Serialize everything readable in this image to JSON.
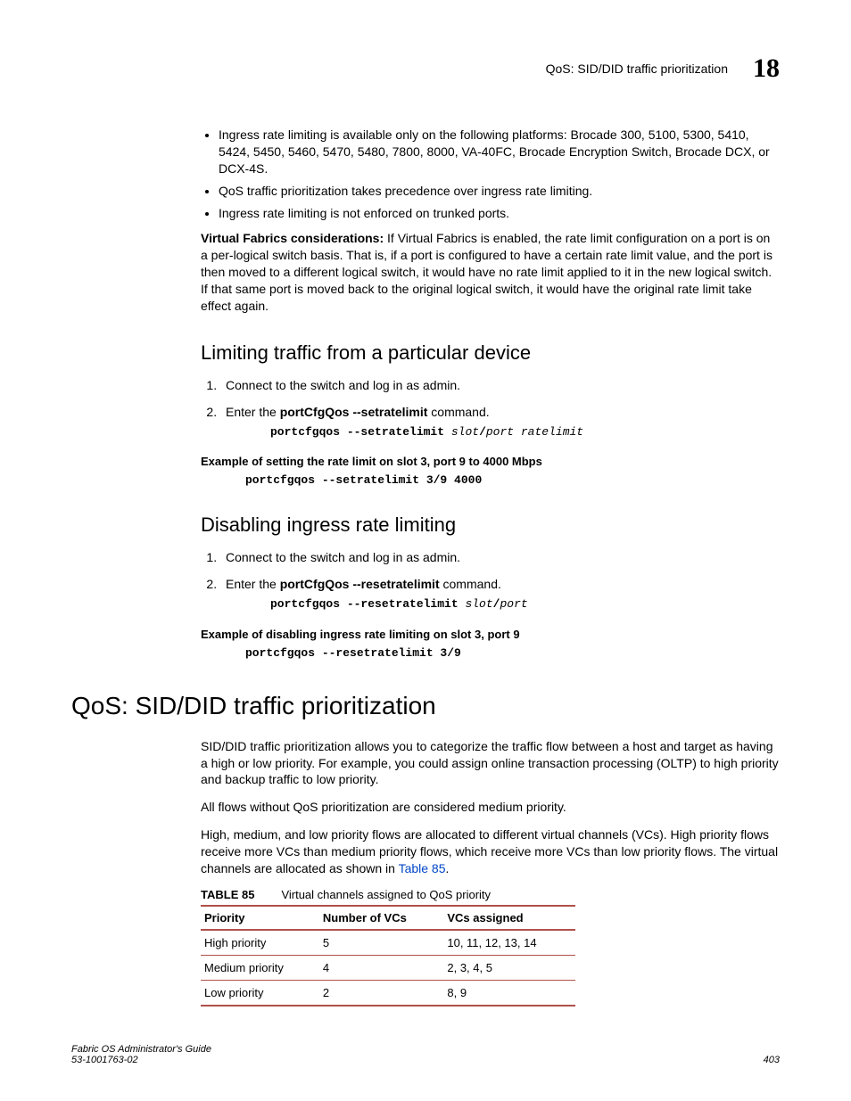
{
  "header": {
    "breadcrumb": "QoS: SID/DID traffic prioritization",
    "chapter_number": "18"
  },
  "bullets": [
    "Ingress rate limiting is available only on the following platforms: Brocade 300, 5100, 5300, 5410, 5424, 5450, 5460, 5470, 5480, 7800, 8000, VA-40FC, Brocade Encryption Switch, Brocade DCX, or DCX-4S.",
    "QoS traffic prioritization takes precedence over ingress rate limiting.",
    "Ingress rate limiting is not enforced on trunked ports."
  ],
  "vf_para_bold": "Virtual Fabrics considerations: ",
  "vf_para": "If Virtual Fabrics is enabled, the rate limit configuration on a port is on a per-logical switch basis. That is, if a port is configured to have a certain rate limit value, and the port is then moved to a different logical switch, it would have no rate limit applied to it in the new logical switch. If that same port is moved back to the original logical switch, it would have the original rate limit take effect again.",
  "section1": {
    "title": "Limiting traffic from a particular device",
    "step1": "Connect to the switch and log in as admin.",
    "step2_pre": "Enter the ",
    "step2_cmd": "portCfgQos --setratelimit",
    "step2_post": " command.",
    "code1_a": "portcfgqos --setratelimit ",
    "code1_b": "slot",
    "code1_c": "/",
    "code1_d": "port ratelimit",
    "ex_head": "Example of setting the rate limit on slot 3, port 9 to 4000 Mbps",
    "ex_code": "portcfgqos --setratelimit 3/9 4000"
  },
  "section2": {
    "title": "Disabling ingress rate limiting",
    "step1": "Connect to the switch and log in as admin.",
    "step2_pre": "Enter the ",
    "step2_cmd": "portCfgQos --resetratelimit",
    "step2_post": " command.",
    "code1_a": "portcfgqos --resetratelimit ",
    "code1_b": "slot",
    "code1_c": "/",
    "code1_d": "port",
    "ex_head": "Example of disabling ingress rate limiting on slot 3, port 9",
    "ex_code": "portcfgqos --resetratelimit 3/9"
  },
  "main_heading": "QoS: SID/DID traffic prioritization",
  "p1": "SID/DID traffic prioritization allows you to categorize the traffic flow between a host and target as having a high or low priority. For example, you could assign online transaction processing (OLTP) to high priority and backup traffic to low priority.",
  "p2": "All flows without QoS prioritization are considered medium priority.",
  "p3_a": "High, medium, and low priority flows are allocated to different virtual channels (VCs). High priority flows receive more VCs than medium priority flows, which receive more VCs than low priority flows. The virtual channels are allocated as shown in ",
  "p3_link": "Table 85",
  "p3_b": ".",
  "table": {
    "id": "TABLE 85",
    "caption": "Virtual channels assigned to QoS priority",
    "headers": [
      "Priority",
      "Number of VCs",
      "VCs assigned"
    ],
    "rows": [
      [
        "High priority",
        "5",
        "10, 11, 12, 13, 14"
      ],
      [
        "Medium priority",
        "4",
        "2, 3, 4, 5"
      ],
      [
        "Low priority",
        "2",
        "8, 9"
      ]
    ]
  },
  "footer": {
    "doc_title": "Fabric OS Administrator's Guide",
    "doc_num": "53-1001763-02",
    "page": "403"
  }
}
